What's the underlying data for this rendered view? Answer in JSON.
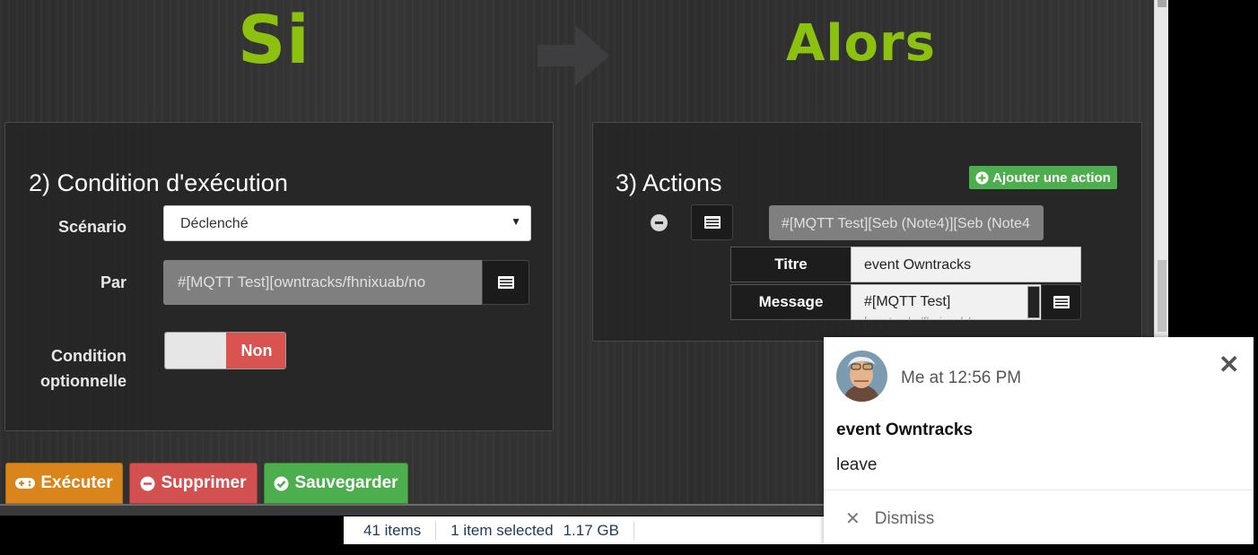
{
  "hero": {
    "si": "Si",
    "alors": "Alors",
    "arrow_icon": "arrow-right-icon",
    "accent_color": "#8cc20f"
  },
  "condition": {
    "title": "2) Condition d'exécution",
    "scenario_label": "Scénario",
    "scenario_value": "Déclenché",
    "par_label": "Par",
    "par_value": "#[MQTT Test][owntracks/fhnixuab/no",
    "optional_label_line1": "Condition",
    "optional_label_line2": "optionnelle",
    "optional_toggle": "Non"
  },
  "actions": {
    "title": "3) Actions",
    "add_button": "Ajouter une action",
    "command_value": "#[MQTT Test][Seb (Note4)][Seb (Note4",
    "titre_label": "Titre",
    "titre_value": "event Owntracks",
    "message_label": "Message",
    "message_value": "#[MQTT Test]",
    "message_value_overflow": "[owntracks/fhnixuab/no"
  },
  "buttons": {
    "execute": "Exécuter",
    "delete": "Supprimer",
    "save": "Sauvegarder"
  },
  "statusbar": {
    "items": "41 items",
    "selected": "1 item selected",
    "size": "1.17 GB"
  },
  "notification": {
    "meta": "Me at 12:56 PM",
    "title": "event Owntracks",
    "body": "leave",
    "dismiss": "Dismiss",
    "close_icon": "close-icon"
  }
}
